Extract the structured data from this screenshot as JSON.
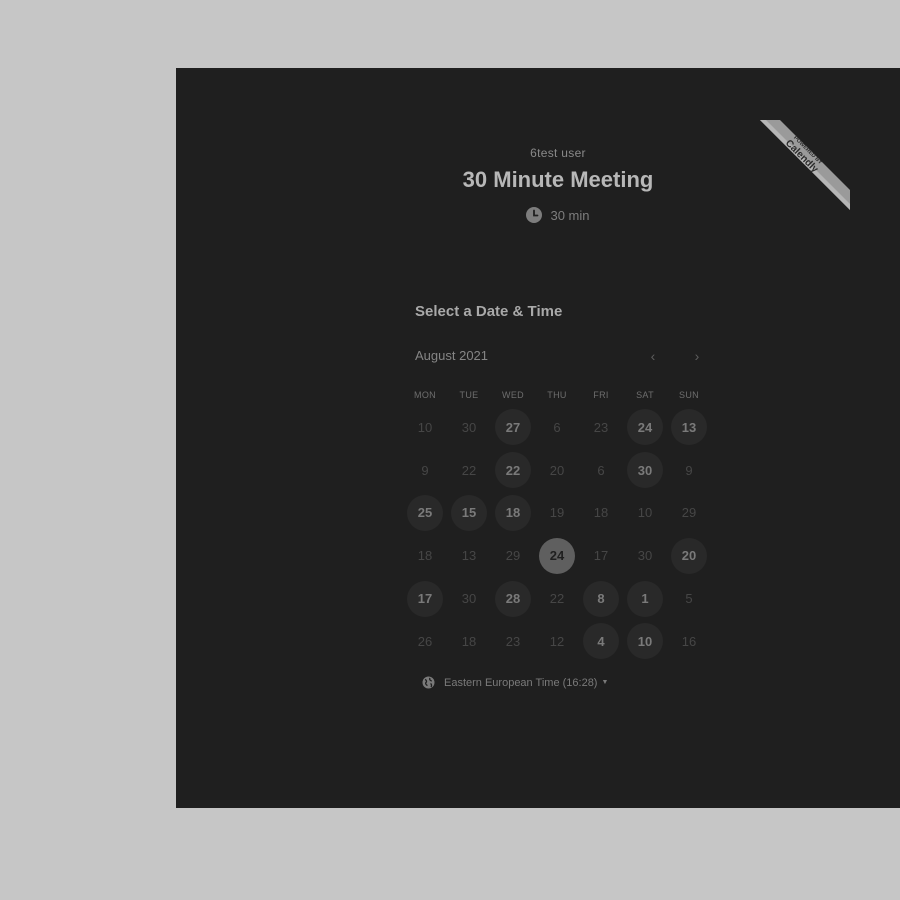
{
  "event": {
    "owner": "6test user",
    "title": "30 Minute Meeting",
    "duration": "30 min"
  },
  "ribbon": {
    "line1": "POWERED BY",
    "brand": "Calendly"
  },
  "calendar": {
    "heading": "Select a Date & Time",
    "month": "August 2021",
    "prev_icon": "chevron-left-icon",
    "next_icon": "chevron-right-icon",
    "weekdays": [
      "MON",
      "TUE",
      "WED",
      "THU",
      "FRI",
      "SAT",
      "SUN"
    ],
    "days": [
      {
        "label": "10",
        "state": "unavailable"
      },
      {
        "label": "30",
        "state": "unavailable"
      },
      {
        "label": "27",
        "state": "available"
      },
      {
        "label": "6",
        "state": "unavailable"
      },
      {
        "label": "23",
        "state": "unavailable"
      },
      {
        "label": "24",
        "state": "available"
      },
      {
        "label": "13",
        "state": "available"
      },
      {
        "label": "9",
        "state": "unavailable"
      },
      {
        "label": "22",
        "state": "unavailable"
      },
      {
        "label": "22",
        "state": "available"
      },
      {
        "label": "20",
        "state": "unavailable"
      },
      {
        "label": "6",
        "state": "unavailable"
      },
      {
        "label": "30",
        "state": "available"
      },
      {
        "label": "9",
        "state": "unavailable"
      },
      {
        "label": "25",
        "state": "available"
      },
      {
        "label": "15",
        "state": "available"
      },
      {
        "label": "18",
        "state": "available"
      },
      {
        "label": "19",
        "state": "unavailable"
      },
      {
        "label": "18",
        "state": "unavailable"
      },
      {
        "label": "10",
        "state": "unavailable"
      },
      {
        "label": "29",
        "state": "unavailable"
      },
      {
        "label": "18",
        "state": "unavailable"
      },
      {
        "label": "13",
        "state": "unavailable"
      },
      {
        "label": "29",
        "state": "unavailable"
      },
      {
        "label": "24",
        "state": "selected"
      },
      {
        "label": "17",
        "state": "unavailable"
      },
      {
        "label": "30",
        "state": "unavailable"
      },
      {
        "label": "20",
        "state": "available"
      },
      {
        "label": "17",
        "state": "available"
      },
      {
        "label": "30",
        "state": "unavailable"
      },
      {
        "label": "28",
        "state": "available"
      },
      {
        "label": "22",
        "state": "unavailable"
      },
      {
        "label": "8",
        "state": "available"
      },
      {
        "label": "1",
        "state": "available"
      },
      {
        "label": "5",
        "state": "unavailable"
      },
      {
        "label": "26",
        "state": "unavailable"
      },
      {
        "label": "18",
        "state": "unavailable"
      },
      {
        "label": "23",
        "state": "unavailable"
      },
      {
        "label": "12",
        "state": "unavailable"
      },
      {
        "label": "4",
        "state": "available"
      },
      {
        "label": "10",
        "state": "available"
      },
      {
        "label": "16",
        "state": "unavailable"
      }
    ]
  },
  "timezone": {
    "label": "Eastern European Time (16:28)",
    "icon": "globe-icon"
  },
  "colors": {
    "page_background": "#c6c6c6",
    "panel_background": "#1f1f1f",
    "available_day_background": "#292929",
    "selected_day_background": "#5f5f5f"
  }
}
